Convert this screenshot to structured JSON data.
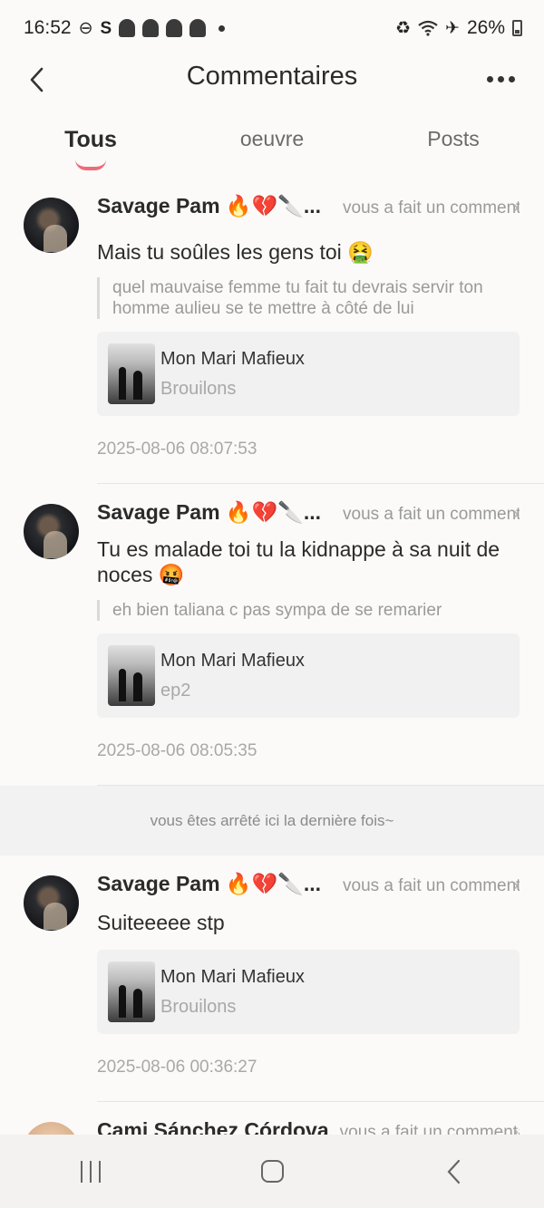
{
  "status_bar": {
    "time": "16:52",
    "battery": "26%",
    "icons": [
      "do-not-disturb-icon",
      "s-icon",
      "snapchat-icon",
      "snapchat-icon",
      "snapchat-icon",
      "snapchat-icon",
      "dot-icon",
      "battery-saver-icon",
      "wifi-icon",
      "airplane-icon",
      "battery-icon"
    ]
  },
  "header": {
    "title": "Commentaires"
  },
  "tabs": [
    {
      "label": "Tous",
      "active": true
    },
    {
      "label": "oeuvre",
      "active": false
    },
    {
      "label": "Posts",
      "active": false
    }
  ],
  "comments": [
    {
      "user": "Savage Pam 🔥💔🔪...",
      "action": "vous a fait un commentaire",
      "text": "Mais tu soûles les gens toi 🤮",
      "quote": "quel mauvaise femme tu fait tu devrais servir ton homme aulieu se te mettre à côté de lui",
      "card_title": "Mon Mari Mafieux",
      "card_sub": "Brouilons",
      "date": "2025-08-06 08:07:53"
    },
    {
      "user": "Savage Pam 🔥💔🔪...",
      "action": "vous a fait un commentaire",
      "text": "Tu es malade toi tu la kidnappe à sa nuit de noces 🤬",
      "quote": "eh bien taliana c pas sympa de se remarier",
      "card_title": "Mon Mari Mafieux",
      "card_sub": "ep2",
      "date": "2025-08-06 08:05:35"
    },
    {
      "user": "Savage Pam 🔥💔🔪...",
      "action": "vous a fait un commentaire",
      "text": "Suiteeeee stp",
      "card_title": "Mon Mari Mafieux",
      "card_sub": "Brouilons",
      "date": "2025-08-06 00:36:27"
    },
    {
      "user": "Cami Sánchez Córdova",
      "action": "vous a fait un commentaire"
    }
  ],
  "separator": "vous êtes arrêté ici la dernière fois~"
}
